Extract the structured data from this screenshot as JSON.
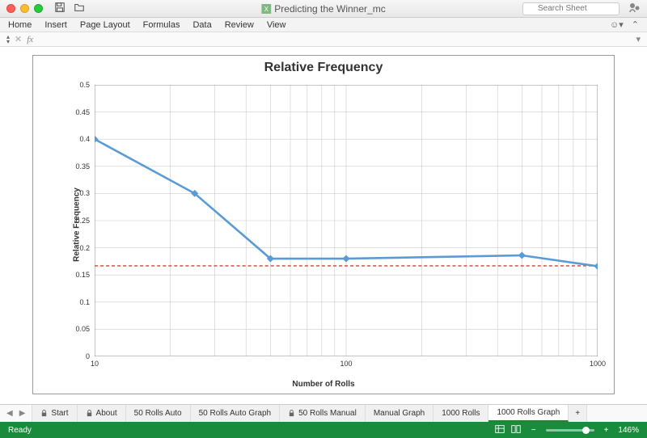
{
  "window": {
    "title": "Predicting the Winner_mc"
  },
  "search": {
    "placeholder": "Search Sheet"
  },
  "ribbon": {
    "tabs": [
      "Home",
      "Insert",
      "Page Layout",
      "Formulas",
      "Data",
      "Review",
      "View"
    ]
  },
  "chart_data": {
    "type": "line",
    "title": "Relative Frequency",
    "xlabel": "Number of Rolls",
    "ylabel": "Relative Frequency",
    "xscale": "log",
    "xlim": [
      10,
      1000
    ],
    "ylim": [
      0,
      0.5
    ],
    "y_ticks": [
      0,
      0.05,
      0.1,
      0.15,
      0.2,
      0.25,
      0.3,
      0.35,
      0.4,
      0.45,
      0.5
    ],
    "x_ticks": [
      10,
      100,
      1000
    ],
    "reference_line": {
      "y": 0.1667,
      "style": "dashed",
      "color": "#d06050"
    },
    "series": [
      {
        "name": "Relative Frequency",
        "color": "#5b9bd5",
        "x": [
          10,
          25,
          50,
          100,
          500,
          1000
        ],
        "y": [
          0.4,
          0.3,
          0.18,
          0.18,
          0.186,
          0.166
        ]
      }
    ]
  },
  "sheets": {
    "tabs": [
      {
        "label": "Start",
        "locked": true
      },
      {
        "label": "About",
        "locked": true
      },
      {
        "label": "50 Rolls Auto",
        "locked": false
      },
      {
        "label": "50 Rolls Auto Graph",
        "locked": false
      },
      {
        "label": "50 Rolls Manual",
        "locked": true
      },
      {
        "label": "Manual Graph",
        "locked": false
      },
      {
        "label": "1000 Rolls",
        "locked": false
      },
      {
        "label": "1000 Rolls Graph",
        "locked": false
      }
    ],
    "active": 7
  },
  "status": {
    "text": "Ready",
    "zoom": "146%"
  }
}
